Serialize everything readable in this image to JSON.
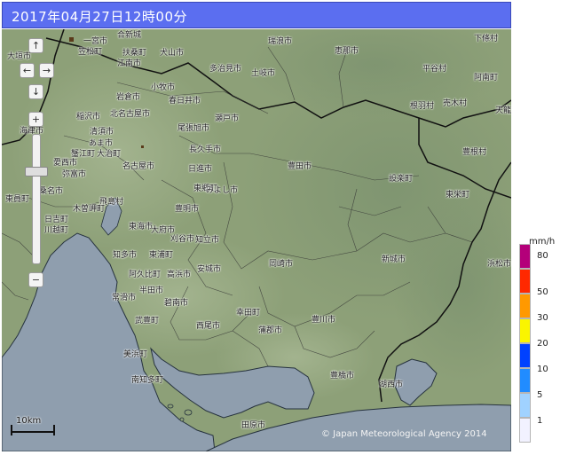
{
  "title": "2017年04月27日12時00分",
  "copyright": "© Japan Meteorological Agency 2014",
  "scale_label": "10km",
  "legend": {
    "unit": "mm/h",
    "levels": [
      {
        "label": "80",
        "color": "#b4007a"
      },
      {
        "label": "50",
        "color": "#ff2800"
      },
      {
        "label": "30",
        "color": "#ff9900"
      },
      {
        "label": "20",
        "color": "#faf500"
      },
      {
        "label": "10",
        "color": "#0041ff"
      },
      {
        "label": "5",
        "color": "#218cff"
      },
      {
        "label": "1",
        "color": "#a0d2ff"
      },
      {
        "label": "",
        "color": "#f2f2ff"
      }
    ]
  },
  "controls": {
    "pan_up": "↑",
    "pan_left": "←",
    "pan_right": "→",
    "pan_down": "↓",
    "zoom_in": "+",
    "zoom_out": "−"
  },
  "cities": [
    "合新城",
    "瑞浪市",
    "恵那市",
    "下條村",
    "大垣市",
    "一宮市",
    "笠松町",
    "扶桑町",
    "犬山市",
    "江南市",
    "多治見市",
    "土岐市",
    "稲沢市",
    "岩倉市",
    "小牧市",
    "春日井市",
    "平谷村",
    "阿南町",
    "北名古屋市",
    "瀬戸市",
    "根羽村",
    "売木村",
    "天龍",
    "海津市",
    "あま市",
    "清須市",
    "尾張旭市",
    "長久手市",
    "蟹江町",
    "大治町",
    "名古屋市",
    "日進市",
    "豊田市",
    "豊根村",
    "愛西市",
    "弥富市",
    "東郷町",
    "みよし市",
    "東栄町",
    "設楽町",
    "桑名市",
    "飛島村",
    "豊明市",
    "東員町",
    "木曽岬町",
    "東海市",
    "大府市",
    "刈谷市",
    "知立市",
    "日吉町",
    "川越町",
    "知多市",
    "東浦町",
    "安城市",
    "岡崎市",
    "新城市",
    "浜松市",
    "阿久比町",
    "高浜市",
    "半田市",
    "常滑市",
    "碧南市",
    "武豊町",
    "幸田町",
    "西尾市",
    "蒲郡市",
    "豊川市",
    "美浜町",
    "南知多町",
    "豊橋市",
    "湖西市",
    "田原市"
  ]
}
